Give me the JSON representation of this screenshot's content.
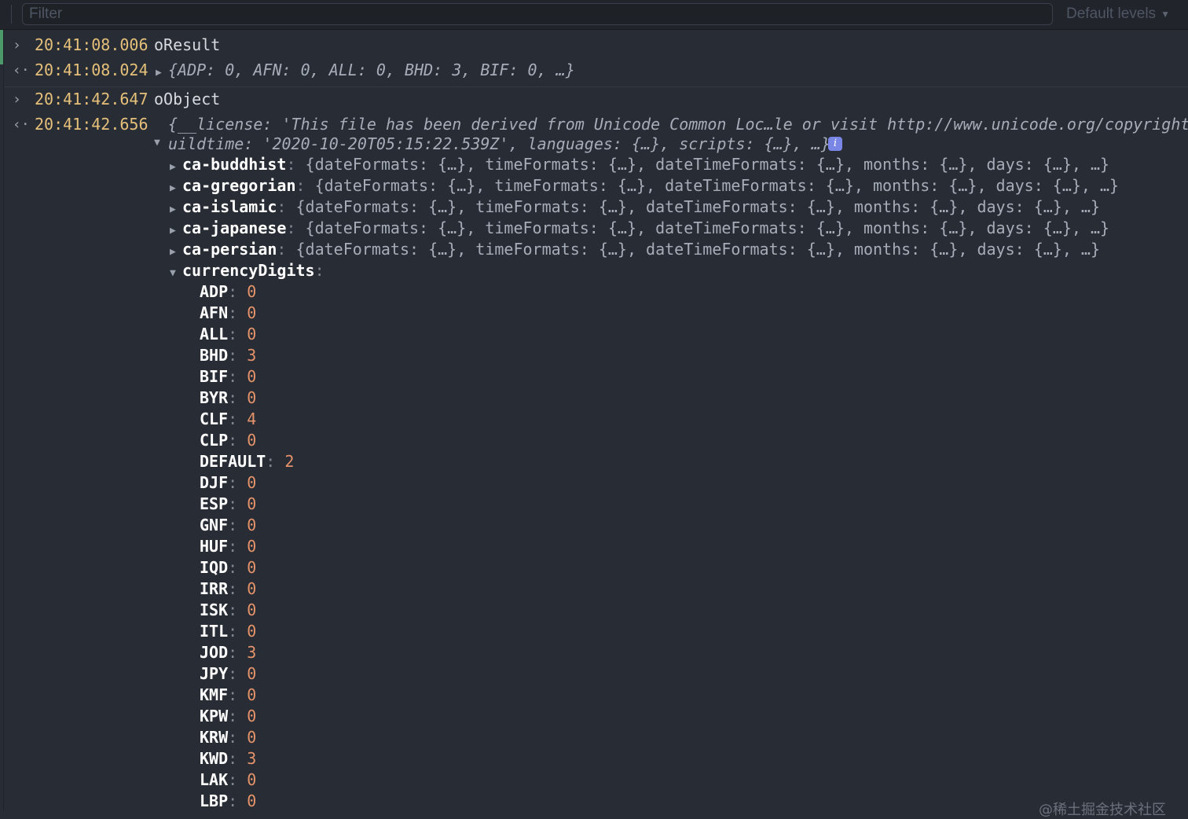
{
  "toolbar": {
    "filter_placeholder": "Filter",
    "filter_value": "",
    "levels_label": "Default levels"
  },
  "console": {
    "log1": {
      "time": "20:41:08.006",
      "text": "oResult"
    },
    "result1": {
      "time": "20:41:08.024",
      "text": "{ADP: 0, AFN: 0, ALL: 0, BHD: 3, BIF: 0, …}"
    },
    "log2": {
      "time": "20:41:42.647",
      "text": "oObject"
    },
    "result2": {
      "time": "20:41:42.656",
      "line1": "{__license: 'This file has been derived from Unicode Common Loc…le or visit http://www.unicode.org/copyright.h",
      "line2": "uildtime: '2020-10-20T05:15:22.539Z', languages: {…}, scripts: {…}, …}",
      "info_badge": "i"
    },
    "calendars": [
      {
        "key": "ca-buddhist",
        "preview": "{dateFormats: {…}, timeFormats: {…}, dateTimeFormats: {…}, months: {…}, days: {…}, …}"
      },
      {
        "key": "ca-gregorian",
        "preview": "{dateFormats: {…}, timeFormats: {…}, dateTimeFormats: {…}, months: {…}, days: {…}, …}"
      },
      {
        "key": "ca-islamic",
        "preview": "{dateFormats: {…}, timeFormats: {…}, dateTimeFormats: {…}, months: {…}, days: {…}, …}"
      },
      {
        "key": "ca-japanese",
        "preview": "{dateFormats: {…}, timeFormats: {…}, dateTimeFormats: {…}, months: {…}, days: {…}, …}"
      },
      {
        "key": "ca-persian",
        "preview": "{dateFormats: {…}, timeFormats: {…}, dateTimeFormats: {…}, months: {…}, days: {…}, …}"
      }
    ],
    "currency_key": "currencyDigits",
    "currency_digits": [
      {
        "code": "ADP",
        "value": "0"
      },
      {
        "code": "AFN",
        "value": "0"
      },
      {
        "code": "ALL",
        "value": "0"
      },
      {
        "code": "BHD",
        "value": "3"
      },
      {
        "code": "BIF",
        "value": "0"
      },
      {
        "code": "BYR",
        "value": "0"
      },
      {
        "code": "CLF",
        "value": "4"
      },
      {
        "code": "CLP",
        "value": "0"
      },
      {
        "code": "DEFAULT",
        "value": "2"
      },
      {
        "code": "DJF",
        "value": "0"
      },
      {
        "code": "ESP",
        "value": "0"
      },
      {
        "code": "GNF",
        "value": "0"
      },
      {
        "code": "HUF",
        "value": "0"
      },
      {
        "code": "IQD",
        "value": "0"
      },
      {
        "code": "IRR",
        "value": "0"
      },
      {
        "code": "ISK",
        "value": "0"
      },
      {
        "code": "ITL",
        "value": "0"
      },
      {
        "code": "JOD",
        "value": "3"
      },
      {
        "code": "JPY",
        "value": "0"
      },
      {
        "code": "KMF",
        "value": "0"
      },
      {
        "code": "KPW",
        "value": "0"
      },
      {
        "code": "KRW",
        "value": "0"
      },
      {
        "code": "KWD",
        "value": "3"
      },
      {
        "code": "LAK",
        "value": "0"
      },
      {
        "code": "LBP",
        "value": "0"
      }
    ]
  },
  "watermark": "@稀土掘金技术社区",
  "colors": {
    "background": "#282c34",
    "timestamp": "#e5c07b",
    "number": "#e5936a",
    "string": "#e8e27e",
    "badge": "#7a86e6"
  }
}
